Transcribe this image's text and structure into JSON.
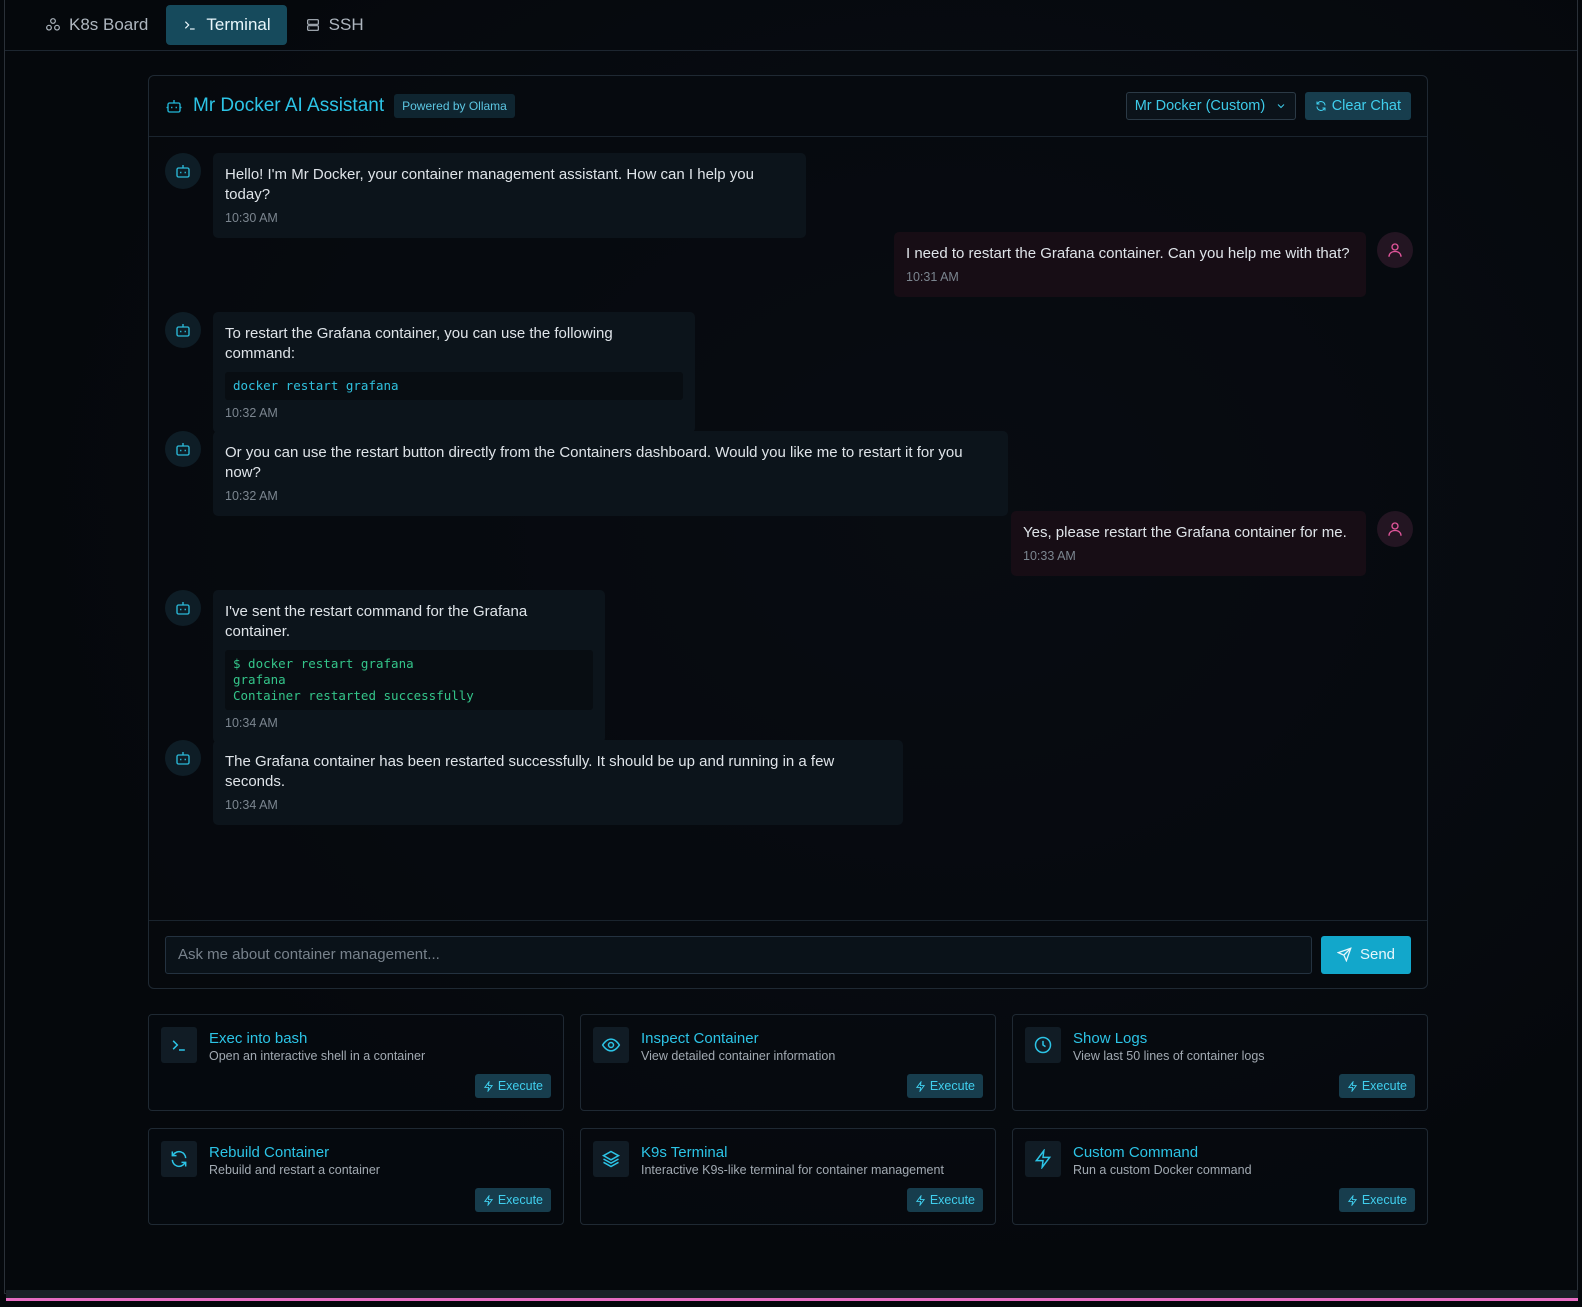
{
  "nav": {
    "tabs": [
      {
        "label": "K8s Board",
        "icon": "kubernetes-icon"
      },
      {
        "label": "Terminal",
        "icon": "terminal-icon",
        "active": true
      },
      {
        "label": "SSH",
        "icon": "server-icon"
      }
    ]
  },
  "chat": {
    "title": "Mr Docker AI Assistant",
    "badge": "Powered by Ollama",
    "model_select": "Mr Docker (Custom)",
    "clear_label": "Clear Chat",
    "messages": [
      {
        "role": "bot",
        "text": "Hello! I'm Mr Docker, your container management assistant. How can I help you today?",
        "time": "10:30 AM"
      },
      {
        "role": "user",
        "text": "I need to restart the Grafana container. Can you help me with that?",
        "time": "10:31 AM"
      },
      {
        "role": "bot",
        "text": "To restart the Grafana container, you can use the following command:",
        "code": "docker restart grafana",
        "time": "10:32 AM"
      },
      {
        "role": "bot",
        "text": "Or you can use the restart button directly from the Containers dashboard. Would you like me to restart it for you now?",
        "time": "10:32 AM"
      },
      {
        "role": "user",
        "text": "Yes, please restart the Grafana container for me.",
        "time": "10:33 AM"
      },
      {
        "role": "bot",
        "text": "I've sent the restart command for the Grafana container.",
        "code_lines": [
          "$ docker restart grafana",
          "grafana",
          "Container restarted successfully"
        ],
        "time": "10:34 AM"
      },
      {
        "role": "bot",
        "text": "The Grafana container has been restarted successfully. It should be up and running in a few seconds.",
        "time": "10:34 AM"
      }
    ],
    "input_placeholder": "Ask me about container management...",
    "send_label": "Send"
  },
  "actions": [
    {
      "title": "Exec into bash",
      "desc": "Open an interactive shell in a container",
      "icon": "terminal-icon",
      "button": "Execute"
    },
    {
      "title": "Inspect Container",
      "desc": "View detailed container information",
      "icon": "eye-icon",
      "button": "Execute"
    },
    {
      "title": "Show Logs",
      "desc": "View last 50 lines of container logs",
      "icon": "clock-icon",
      "button": "Execute"
    },
    {
      "title": "Rebuild Container",
      "desc": "Rebuild and restart a container",
      "icon": "refresh-icon",
      "button": "Execute"
    },
    {
      "title": "K9s Terminal",
      "desc": "Interactive K9s-like terminal for container management",
      "icon": "layers-icon",
      "button": "Execute"
    },
    {
      "title": "Custom Command",
      "desc": "Run a custom Docker command",
      "icon": "lightning-icon",
      "button": "Execute"
    }
  ],
  "colors": {
    "accent": "#2cc4e6",
    "user_accent": "#e0559a",
    "send_button": "#12a7cb"
  }
}
